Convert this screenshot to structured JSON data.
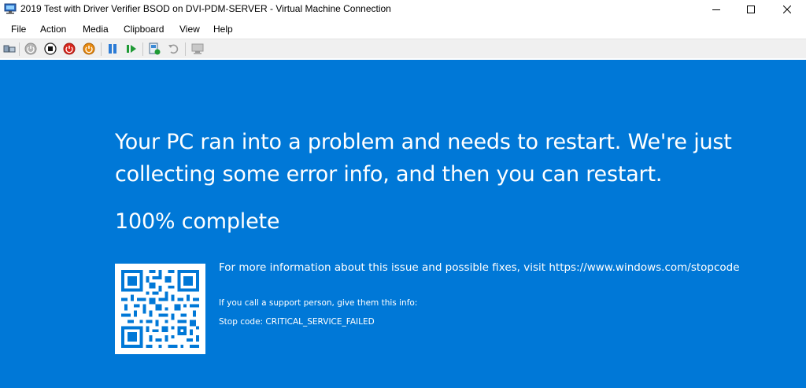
{
  "window": {
    "title": "2019 Test with Driver Verifier BSOD on DVI-PDM-SERVER - Virtual Machine Connection",
    "icon": "vm-connection-icon"
  },
  "menu": {
    "items": [
      {
        "label": "File"
      },
      {
        "label": "Action"
      },
      {
        "label": "Media"
      },
      {
        "label": "Clipboard"
      },
      {
        "label": "View"
      },
      {
        "label": "Help"
      }
    ]
  },
  "toolbar": {
    "buttons": [
      "ctrl-alt-del-icon",
      "start-icon",
      "turn-off-icon",
      "shut-down-icon",
      "save-icon",
      "pause-icon",
      "resume-icon",
      "checkpoint-icon",
      "revert-icon",
      "enhanced-session-icon"
    ]
  },
  "bsod": {
    "headline": "Your PC ran into a problem and needs to restart. We're just collecting some error info, and then you can restart.",
    "progress": "100% complete",
    "info": "For more information about this issue and possible fixes, visit https://www.windows.com/stopcode",
    "support": "If you call a support person, give them this info:",
    "stop_code": "Stop code: CRITICAL_SERVICE_FAILED"
  },
  "colors": {
    "bsod_background": "#0078d7",
    "toolbar_background": "#f0f0f0"
  }
}
